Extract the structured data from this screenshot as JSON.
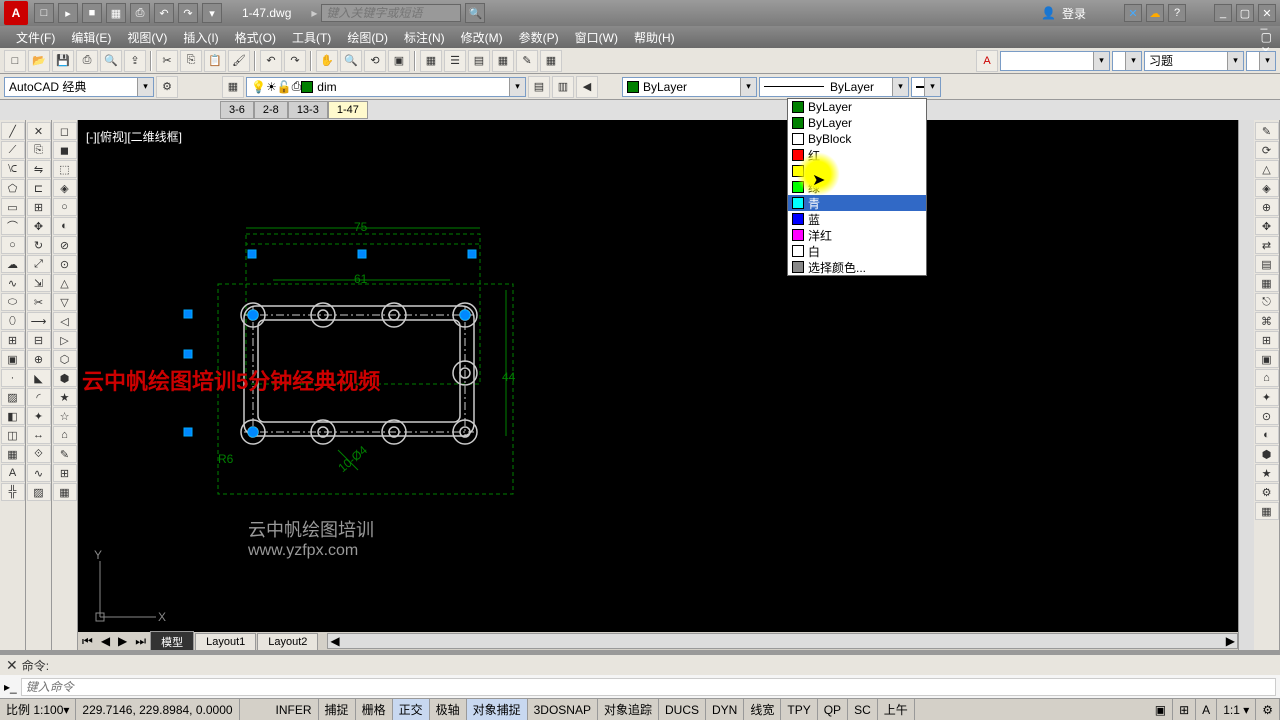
{
  "title": "1-47.dwg",
  "search_placeholder": "键入关键字或短语",
  "login_label": "登录",
  "menus": [
    "文件(F)",
    "编辑(E)",
    "视图(V)",
    "插入(I)",
    "格式(O)",
    "工具(T)",
    "绘图(D)",
    "标注(N)",
    "修改(M)",
    "参数(P)",
    "窗口(W)",
    "帮助(H)"
  ],
  "workspace": "AutoCAD 经典",
  "layer_current": "dim",
  "color_current": "ByLayer",
  "linetype_current": "ByLayer",
  "lineweight_combo": "习题",
  "model_tabs": [
    "3-6",
    "2-8",
    "13-3",
    "1-47"
  ],
  "active_model_tab": "1-47",
  "layout_tabs": [
    "模型",
    "Layout1",
    "Layout2"
  ],
  "view_label": "[-][俯视][二维线框]",
  "dims": {
    "d75": "75",
    "d61": "61",
    "d44": "44",
    "r6": "R6",
    "a14": "10-Ø4"
  },
  "watermark_red": "云中帆绘图培训5分钟经典视频",
  "watermark_white": "云中帆绘图培训",
  "watermark_url": "www.yzfpx.com",
  "cmd_prompt": "命令:",
  "cmd_hint": "键入命令",
  "status": {
    "scale": "比例 1:100",
    "coords": "229.7146, 229.8984, 0.0000",
    "toggles": [
      "INFER",
      "捕捉",
      "栅格",
      "正交",
      "极轴",
      "对象捕捉",
      "3DOSNAP",
      "对象追踪",
      "DUCS",
      "DYN",
      "线宽",
      "TPY",
      "QP",
      "SC",
      "上午"
    ]
  },
  "color_list": [
    {
      "name": "ByLayer",
      "color": "#008000"
    },
    {
      "name": "ByLayer",
      "color": "#008000"
    },
    {
      "name": "ByBlock",
      "color": "#ffffff"
    },
    {
      "name": "红",
      "color": "#ff0000"
    },
    {
      "name": "黄",
      "color": "#ffff00"
    },
    {
      "name": "绿",
      "color": "#00ff00"
    },
    {
      "name": "青",
      "color": "#00ffff"
    },
    {
      "name": "蓝",
      "color": "#0000ff"
    },
    {
      "name": "洋红",
      "color": "#ff00ff"
    },
    {
      "name": "白",
      "color": "#ffffff"
    },
    {
      "name": "选择颜色...",
      "color": "#888888"
    }
  ],
  "chart_data": {
    "type": "cad_drawing",
    "outer_width": 75,
    "inner_width": 61,
    "height": 44,
    "corner_radius": 6,
    "hole_dia": 4,
    "hole_count": 10
  }
}
